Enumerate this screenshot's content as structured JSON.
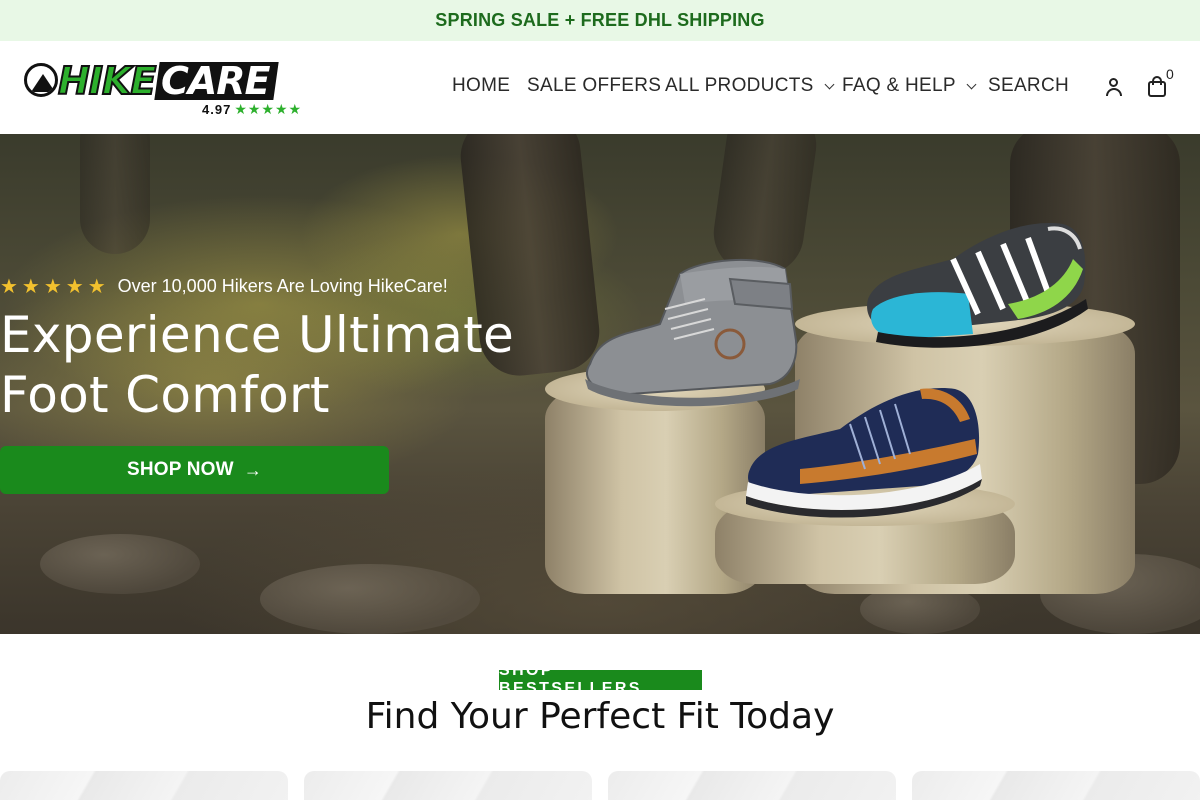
{
  "announcement": {
    "text": "SPRING SALE + FREE DHL SHIPPING"
  },
  "header": {
    "logo": {
      "word_left": "HIKE",
      "word_right": "CARE",
      "rating": "4.97",
      "stars": "★★★★★"
    },
    "nav": [
      {
        "label": "HOME"
      },
      {
        "label": "SALE OFFERS"
      },
      {
        "label": "ALL PRODUCTS",
        "has_dropdown": true
      },
      {
        "label": "FAQ & HELP",
        "has_dropdown": true
      },
      {
        "label": "SEARCH"
      }
    ],
    "account_icon": "user-icon",
    "cart_icon": "shopping-bag-icon",
    "cart_count": "0"
  },
  "hero": {
    "stars": "★★★★★",
    "rating_text": "Over 10,000 Hikers Are Loving HikeCare!",
    "title_line1": "Experience Ultimate",
    "title_line2": "Foot Comfort",
    "cta_label": "SHOP NOW",
    "cta_arrow": "→"
  },
  "bestsellers": {
    "badge": "SHOP BESTSELLERS",
    "title": "Find Your Perfect Fit Today",
    "cards": 4
  },
  "colors": {
    "announcement_bg": "#e8f8e6",
    "announcement_text": "#1d6b1d",
    "brand_green": "#1a8a1c",
    "star_yellow": "#f2c12e"
  }
}
